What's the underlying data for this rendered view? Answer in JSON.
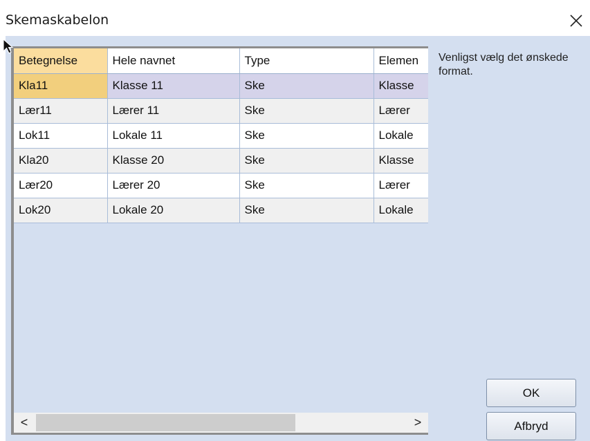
{
  "window": {
    "title": "Skemaskabelon"
  },
  "grid": {
    "columns": [
      "Betegnelse",
      "Hele navnet",
      "Type",
      "Elemen"
    ],
    "rows": [
      [
        "Kla11",
        "Klasse 11",
        "Ske",
        "Klasse"
      ],
      [
        "Lær11",
        "Lærer 11",
        "Ske",
        "Lærer"
      ],
      [
        "Lok11",
        "Lokale 11",
        "Ske",
        "Lokale"
      ],
      [
        "Kla20",
        "Klasse 20",
        "Ske",
        "Klasse"
      ],
      [
        "Lær20",
        "Lærer 20",
        "Ske",
        "Lærer"
      ],
      [
        "Lok20",
        "Lokale 20",
        "Ske",
        "Lokale"
      ]
    ],
    "selected_row": 0
  },
  "scrollbar": {
    "left_arrow": "<",
    "right_arrow": ">"
  },
  "info_text": "Venligst vælg det ønskede format.",
  "buttons": {
    "ok": "OK",
    "cancel": "Afbryd"
  },
  "icons": {
    "close": "close-icon",
    "cursor": "cursor-arrow-icon"
  }
}
